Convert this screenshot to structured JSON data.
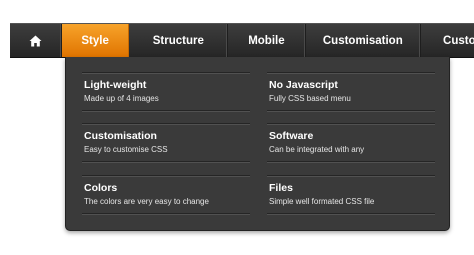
{
  "nav": {
    "items": [
      {
        "id": "home",
        "icon": "home-icon",
        "label": ""
      },
      {
        "id": "style",
        "label": "Style",
        "active": true
      },
      {
        "id": "structure",
        "label": "Structure"
      },
      {
        "id": "mobile",
        "label": "Mobile"
      },
      {
        "id": "customisation",
        "label": "Customisation"
      },
      {
        "id": "customisation-2",
        "label": "Custom"
      }
    ]
  },
  "dropdown": {
    "items": [
      {
        "title": "Light-weight",
        "desc": "Made up of 4 images"
      },
      {
        "title": "No Javascript",
        "desc": "Fully CSS based menu"
      },
      {
        "title": "Customisation",
        "desc": "Easy to customise CSS"
      },
      {
        "title": "Software",
        "desc": "Can be integrated with any"
      },
      {
        "title": "Colors",
        "desc": "The colors are very easy to change"
      },
      {
        "title": "Files",
        "desc": "Simple well formated CSS file"
      }
    ]
  },
  "colors": {
    "accent": "#f08a10",
    "bar": "#2e2e2e",
    "dropdown": "#3a3a3a",
    "text": "#ffffff"
  }
}
